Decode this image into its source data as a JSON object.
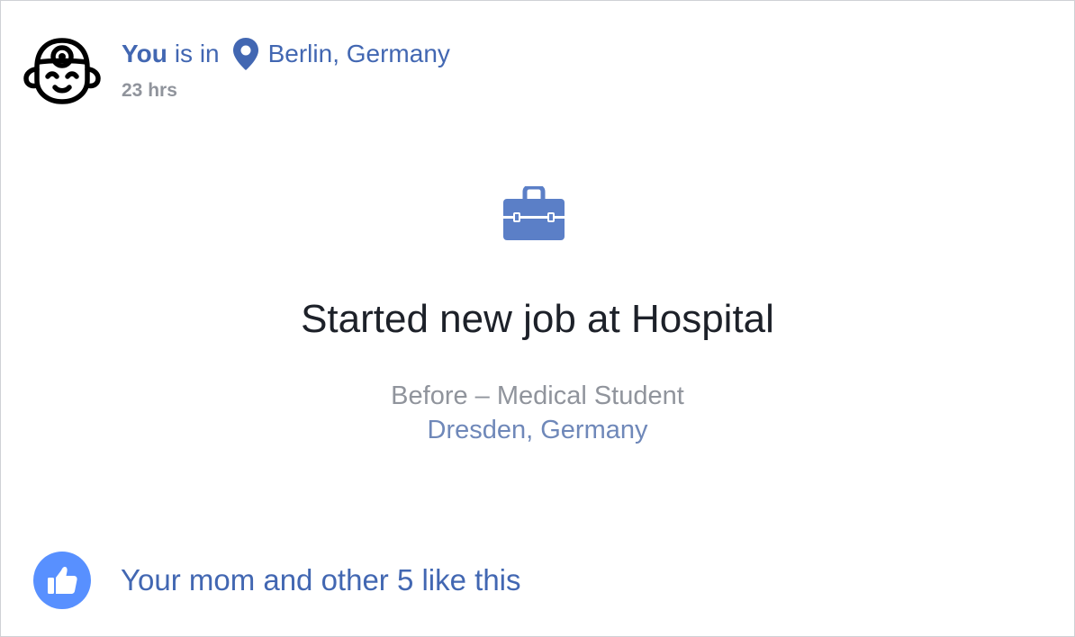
{
  "post": {
    "author": "You",
    "connector": "is in",
    "location": "Berlin, Germany",
    "location_icon": "location-pin-icon",
    "timestamp": "23 hrs",
    "avatar_icon": "doctor-avatar-icon"
  },
  "life_event": {
    "icon": "briefcase-icon",
    "title": "Started new job at Hospital",
    "before": "Before – Medical Student",
    "place": "Dresden, Germany"
  },
  "reactions": {
    "icon": "thumbs-up-icon",
    "text": "Your mom and other 5 like this"
  },
  "colors": {
    "brand_blue": "#4267b2",
    "like_blue": "#5890ff",
    "muted_gray": "#90949c",
    "briefcase_blue": "#5b7fc7"
  }
}
